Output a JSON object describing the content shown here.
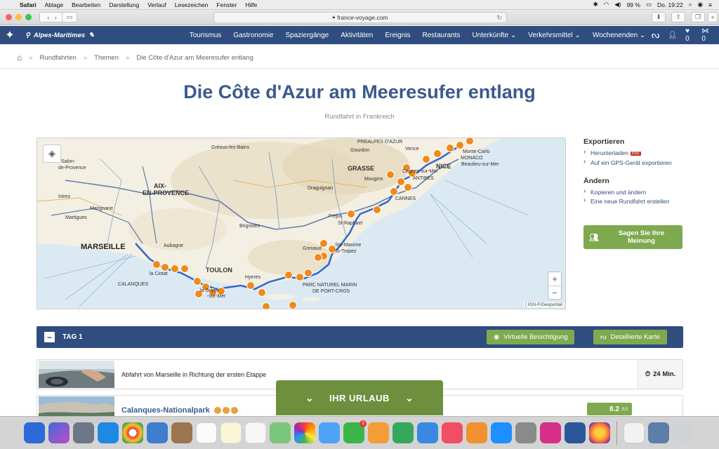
{
  "menubar": {
    "app": "Safari",
    "items": [
      "Ablage",
      "Bearbeiten",
      "Darstellung",
      "Verlauf",
      "Lesezeichen",
      "Fenster",
      "Hilfe"
    ],
    "battery": "99 %",
    "clock": "Do. 19:22"
  },
  "browser": {
    "url": "france-voyage.com"
  },
  "sitenav": {
    "region": "Alpes-Maritimes",
    "items": [
      "Tourismus",
      "Gastronomie",
      "Spaziergänge",
      "Aktivitäten",
      "Ereignis",
      "Restaurants",
      "Unterkünfte ⌄",
      "Verkehrsmittel ⌄",
      "Wochenenden ⌄"
    ],
    "favorites_count": "0",
    "share_count": "0"
  },
  "breadcrumb": {
    "items": [
      "Rundfahrten",
      "Themen",
      "Die Côte d'Azur am Meeresufer entlang"
    ]
  },
  "page": {
    "title": "Die Côte d'Azur am Meeresufer entlang",
    "subtitle": "Rundfahrt in Frankreich"
  },
  "map": {
    "labels": {
      "marseille": "MARSEILLE",
      "aix": "AIX-",
      "aix2": "EN-PROVENCE",
      "toulon": "TOULON",
      "nice": "NICE",
      "grasse": "GRASSE",
      "antibes": "ANTIBES",
      "cannes": "CANNES",
      "monaco": "MONACO",
      "draguignan": "Draguignan",
      "hyeres": "Hyeres",
      "frejus": "Frejus",
      "raphael": "St-Raphael",
      "tropez": "St-Tropez",
      "maxime": "Ste-Maxime",
      "grimaud": "Grimaud",
      "ciotat": "la Ciotat",
      "seyne": "la Seyne",
      "seyne2": "-sur-Mer",
      "martigues": "Martigues",
      "marignane": "Marignane",
      "salon": "Salon-",
      "salon2": "de-Provence",
      "istres": "Istres",
      "brignoles": "Brignoles",
      "aubagne": "Aubagne",
      "calanques": "CALANQUES",
      "parc": "PARC NATUREL MARIN",
      "parc2": "DE PORT-CROS",
      "prealpes": "PREALPES D'AZUR",
      "vence": "Vence",
      "menton": "Monte-Carlo",
      "beaulieu": "Beaulieu-sur-Mer",
      "cagnes": "Cagnes-sur-Mer",
      "gourdon": "Gourdon",
      "mougins": "Mougins",
      "greoux": "Gréoux-les-Bains"
    },
    "attribution": "| IGN-F/Geoportail",
    "zoom_in": "+",
    "zoom_out": "−"
  },
  "sidebar": {
    "export_title": "Exportieren",
    "download": "Herunterladen",
    "pdf": "PDF",
    "gps": "Auf ein GPS-Gerät exportieren",
    "edit_title": "Ändern",
    "copy": "Kopieren und ändern",
    "new_tour": "Eine neue Rundfahrt erstellen",
    "review": "Sagen Sie Ihre Meinung"
  },
  "day": {
    "title": "TAG 1",
    "virtual": "Virtuelle Besichtigung",
    "detail_map": "Detaillierte Karte"
  },
  "stages": [
    {
      "desc": "Abfahrt von Marseille in Richtung der ersten Etappe",
      "duration": "24 Min."
    },
    {
      "name": "Calanques-Nationalpark",
      "score": "8.2",
      "score_max": "/10"
    }
  ],
  "urlaub": "IHR URLAUB",
  "colors": {
    "nav_blue": "#2f4d7e",
    "title_blue": "#3a5a8e",
    "green": "#7fa94f",
    "marker_orange": "#ef8a1a"
  }
}
